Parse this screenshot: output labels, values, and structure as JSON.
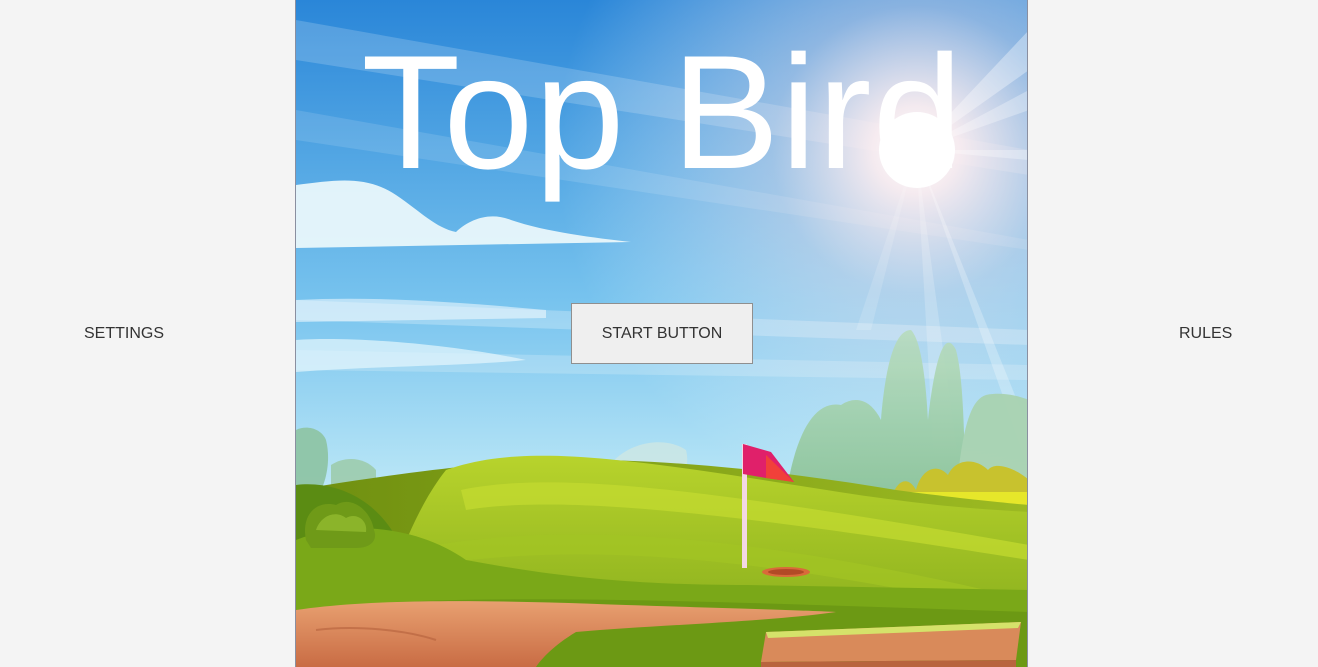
{
  "menu": {
    "settings_label": "SETTINGS",
    "rules_label": "RULES",
    "start_label": "START BUTTON"
  },
  "game": {
    "title": "Top Bird"
  },
  "colors": {
    "page_background": "#f4f4f4",
    "sky_top": "#2a86d8",
    "sky_bottom": "#bfe9f7",
    "grass_light": "#a8c928",
    "grass_dark": "#5f8a12",
    "flag": "#e0206a",
    "sand": "#d98a5a",
    "title_text": "#ffffff"
  },
  "icons": {
    "golf_flag": "golf-flag-icon",
    "sun": "sun-icon"
  }
}
